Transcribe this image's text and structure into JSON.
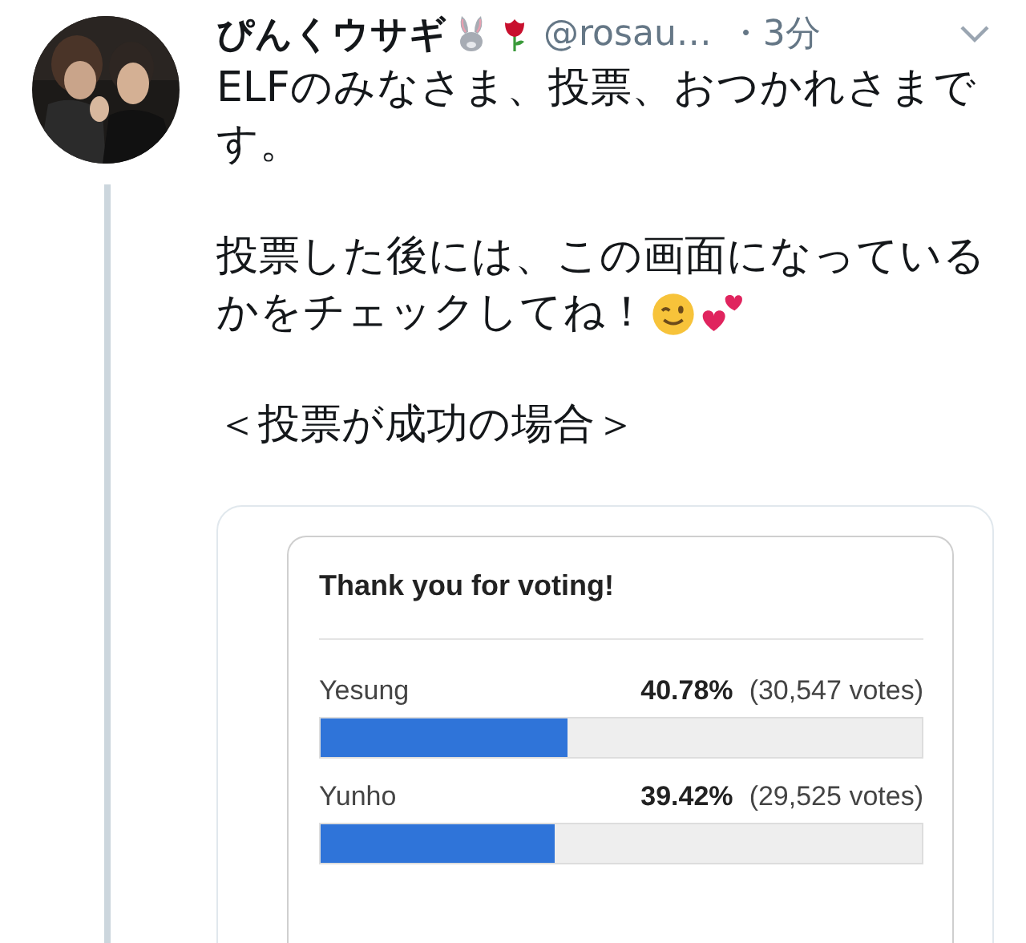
{
  "tweet": {
    "display_name": "ぴんくウサギ",
    "handle": "@rosau…",
    "time": "・3分",
    "paragraphs": [
      {
        "kind": "plain",
        "lines": [
          "ELFのみなさま、投票、おつかれさまで",
          "す。"
        ]
      },
      {
        "kind": "emoji",
        "lines": [
          "投票した後には、この画面になっている",
          "かをチェックしてね！"
        ]
      },
      {
        "kind": "plain",
        "lines": [
          "＜投票が成功の場合＞"
        ]
      }
    ]
  },
  "poll": {
    "title": "Thank you for voting!",
    "options": [
      {
        "name": "Yesung",
        "percent": "40.78%",
        "votes": "(30,547 votes)",
        "level": 0.41
      },
      {
        "name": "Yunho",
        "percent": "39.42%",
        "votes": "(29,525 votes)",
        "level": 0.39
      }
    ]
  }
}
